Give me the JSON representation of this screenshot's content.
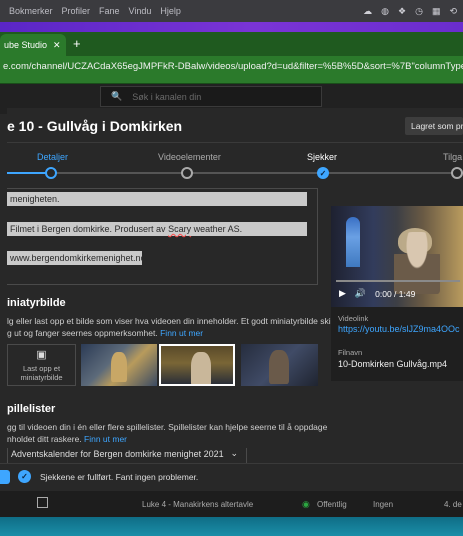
{
  "menubar": {
    "items": [
      "Bokmerker",
      "Profiler",
      "Fane",
      "Vindu",
      "Hjelp"
    ],
    "tray_icons": [
      "cloud-icon",
      "circle-icon",
      "dropbox-icon",
      "clock-icon",
      "grid-icon",
      "timer-icon"
    ]
  },
  "browser": {
    "tab_title": "ube Studio",
    "tab_close": "✕",
    "new_tab": "+",
    "url": "e.com/channel/UCZACdaX65egJMPFkR-DBalw/videos/upload?d=ud&filter=%5B%5D&sort=%7B\"columnType\"%3A\"d"
  },
  "studio": {
    "search_placeholder": "Søk i kanalen din"
  },
  "dialog": {
    "title": "e 10 - Gullvåg i Domkirken",
    "saved_label": "Lagret som pri",
    "steps": [
      {
        "label": "Detaljer",
        "state": "current",
        "color": "#3ea6ff"
      },
      {
        "label": "Videoelementer",
        "state": "pending",
        "color": "#aaaaaa"
      },
      {
        "label": "Sjekker",
        "state": "done",
        "color": "#ffffff"
      },
      {
        "label": "Tilga",
        "state": "pending",
        "color": "#aaaaaa"
      }
    ],
    "description_lines": [
      "menigheten.",
      "Filmet i Bergen domkirke. Produsert av Scary weather AS.",
      "www.bergendomkirkemenighet.no"
    ],
    "description_misspelled": "Scary",
    "thumbnail": {
      "heading": "iniatyrbilde",
      "help_line1": "lg eller last opp et bilde som viser hva videoen din inneholder. Et godt miniatyrbilde skiller",
      "help_line2": "g ut og fanger seernes oppmerksomhet.",
      "link": "Finn ut mer",
      "upload_label": "Last opp et miniatyrbilde",
      "selected_index": 1
    },
    "playlist": {
      "heading": "pillelister",
      "help_line1": "gg til videoen din i én eller flere spillelister. Spillelister kan hjelpe seerne til å oppdage",
      "help_line2": "nholdet ditt raskere.",
      "link": "Finn ut mer",
      "value": "Adventskalender for Bergen domkirke menighet 2021"
    },
    "video": {
      "time": "0:00 / 1:49",
      "link_label": "Videolink",
      "link": "https://youtu.be/slJZ9ma4OOc",
      "filename_label": "Filnavn",
      "filename": "10-Domkirken Gullvåg.mp4"
    }
  },
  "status": {
    "text": "Sjekkene er fullført. Fant ingen problemer."
  },
  "table_row": {
    "title": "Luke 4 - Manakirkens altertavle",
    "visibility": "Offentlig",
    "restrictions": "Ingen",
    "date": "4. de"
  },
  "colors": {
    "accent": "#3ea6ff",
    "browser_green": "#2b7a2b",
    "menubar_purple": "#6a2dce",
    "public_green": "#2ba640"
  }
}
